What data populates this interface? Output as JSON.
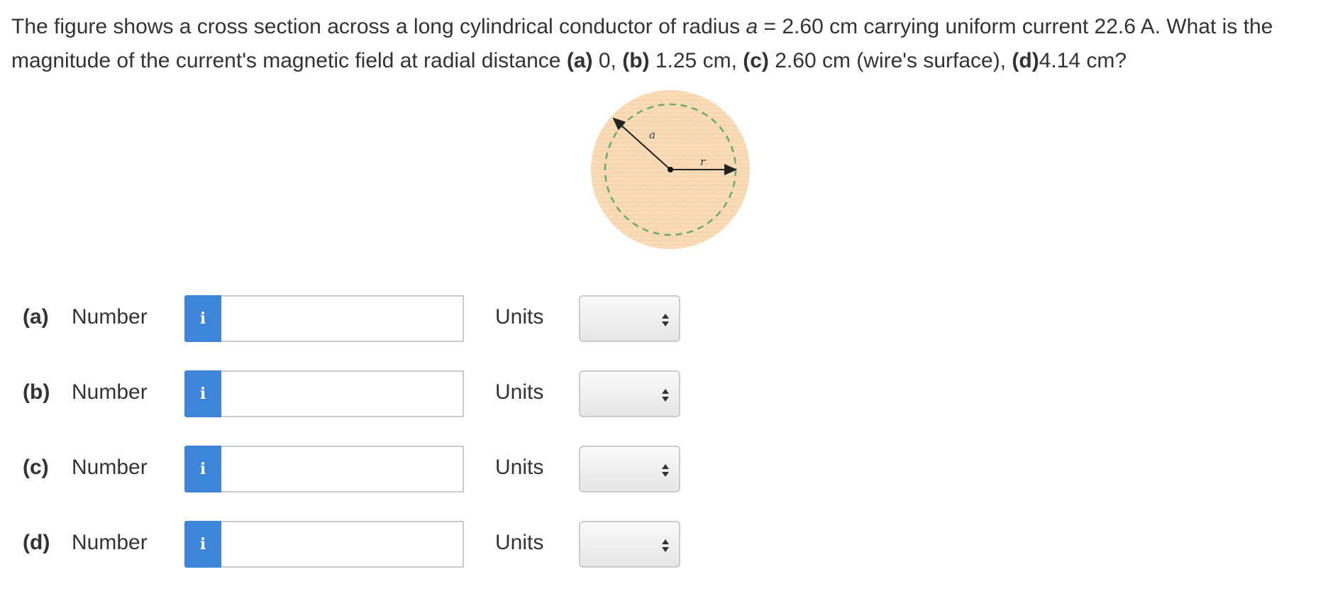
{
  "question": {
    "part1": "The figure shows a cross section across a long cylindrical conductor of radius ",
    "var_a": "a",
    "part2": " = 2.60 cm carrying uniform current 22.6 A. What is the magnitude of the current's magnetic field at radial distance ",
    "label_a": "(a)",
    "text_a": " 0, ",
    "label_b": "(b)",
    "text_b": " 1.25 cm, ",
    "label_c": "(c)",
    "text_c": " 2.60 cm (wire's surface), ",
    "label_d": "(d)",
    "text_d": "4.14 cm?"
  },
  "figure": {
    "label_a": "a",
    "label_r": "r"
  },
  "colors": {
    "info_button": "#3d85d8",
    "disc_fill": "#f9dcb8",
    "dashed_circle": "#6aab6d"
  },
  "rows": [
    {
      "part": "(a)",
      "number_label": "Number",
      "info_icon": "i",
      "value": "",
      "units_label": "Units",
      "units_selected": ""
    },
    {
      "part": "(b)",
      "number_label": "Number",
      "info_icon": "i",
      "value": "",
      "units_label": "Units",
      "units_selected": ""
    },
    {
      "part": "(c)",
      "number_label": "Number",
      "info_icon": "i",
      "value": "",
      "units_label": "Units",
      "units_selected": ""
    },
    {
      "part": "(d)",
      "number_label": "Number",
      "info_icon": "i",
      "value": "",
      "units_label": "Units",
      "units_selected": ""
    }
  ]
}
